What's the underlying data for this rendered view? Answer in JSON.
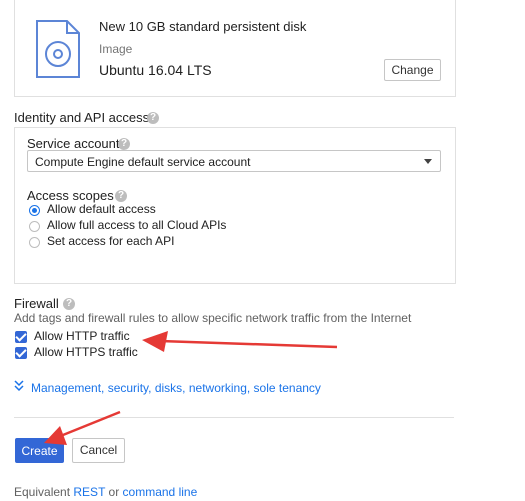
{
  "boot_disk": {
    "title": "New 10 GB standard persistent disk",
    "image_label": "Image",
    "image_value": "Ubuntu 16.04 LTS",
    "change_label": "Change"
  },
  "identity": {
    "heading": "Identity and API access",
    "service_account_label": "Service account",
    "service_account_value": "Compute Engine default service account",
    "access_scopes_label": "Access scopes",
    "scopes": [
      {
        "label": "Allow default access",
        "selected": true
      },
      {
        "label": "Allow full access to all Cloud APIs",
        "selected": false
      },
      {
        "label": "Set access for each API",
        "selected": false
      }
    ]
  },
  "firewall": {
    "heading": "Firewall",
    "description": "Add tags and firewall rules to allow specific network traffic from the Internet",
    "options": [
      {
        "label": "Allow HTTP traffic",
        "checked": true
      },
      {
        "label": "Allow HTTPS traffic",
        "checked": true
      }
    ]
  },
  "more_link": "Management, security, disks, networking, sole tenancy",
  "actions": {
    "create_label": "Create",
    "cancel_label": "Cancel"
  },
  "footer": {
    "prefix": "Equivalent",
    "rest_label": "REST",
    "or_label": "or",
    "command_line_label": "command line"
  },
  "colors": {
    "accent": "#1a73e8",
    "primary_button": "#3367d6",
    "annotation_arrow": "#e53935"
  },
  "icons": {
    "disk": "disk-icon",
    "help": "help-icon",
    "dropdown": "dropdown-arrow-icon",
    "expand": "double-chevron-down-icon"
  }
}
